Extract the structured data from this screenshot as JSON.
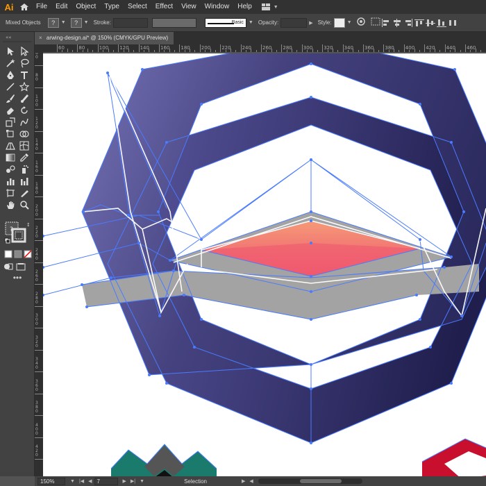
{
  "app": {
    "logo": "Ai"
  },
  "menu": [
    "File",
    "Edit",
    "Object",
    "Type",
    "Select",
    "Effect",
    "View",
    "Window",
    "Help"
  ],
  "control": {
    "selection_label": "Mixed Objects",
    "fill_glyph": "?",
    "stroke_glyph": "?",
    "stroke_label": "Stroke:",
    "brush_label": "Basic",
    "opacity_label": "Opacity:",
    "style_label": "Style:"
  },
  "document": {
    "tab_title": "arwing-design.ai* @ 150% (CMYK/GPU Preview)",
    "close_glyph": "×"
  },
  "ruler": {
    "h_labels": [
      "60",
      "80",
      "100",
      "120",
      "140",
      "160",
      "180",
      "200",
      "220",
      "240",
      "260",
      "280",
      "300",
      "320",
      "340",
      "360",
      "380",
      "400",
      "420",
      "440",
      "460"
    ],
    "v_labels": [
      "60",
      "80",
      "100",
      "120",
      "140",
      "160",
      "180",
      "200",
      "220",
      "240",
      "260",
      "280",
      "300",
      "320",
      "340",
      "360",
      "380",
      "400",
      "420"
    ]
  },
  "status": {
    "zoom": "150%",
    "artboard": "7",
    "tool_label": "Selection"
  },
  "colors": {
    "hex_dark": "#3a3878",
    "hex_light": "#6f6cb0",
    "hex_mid": "#4e4b8c",
    "wing_gray": "#a3a3a3",
    "cockpit_top": "#f5836f",
    "cockpit_bottom": "#ef5a6e",
    "selection": "#4a7bff",
    "teal": "#1a7a6c",
    "red": "#c8102e"
  },
  "icons": [
    "home-icon",
    "workspace-icon",
    "help-icon",
    "selection-icon",
    "direct-select-icon",
    "pen-icon",
    "type-icon",
    "line-icon",
    "rect-icon",
    "brush-icon",
    "pencil-icon",
    "eraser-icon",
    "rotate-icon",
    "scale-icon",
    "warp-icon",
    "free-transform-icon",
    "shape-builder-icon",
    "gradient-icon",
    "eyedropper-icon",
    "blend-icon",
    "symbol-icon",
    "graph-icon",
    "artboard-icon",
    "slice-icon",
    "hand-icon",
    "zoom-icon",
    "fill-stroke-icon",
    "more-tools-icon"
  ]
}
